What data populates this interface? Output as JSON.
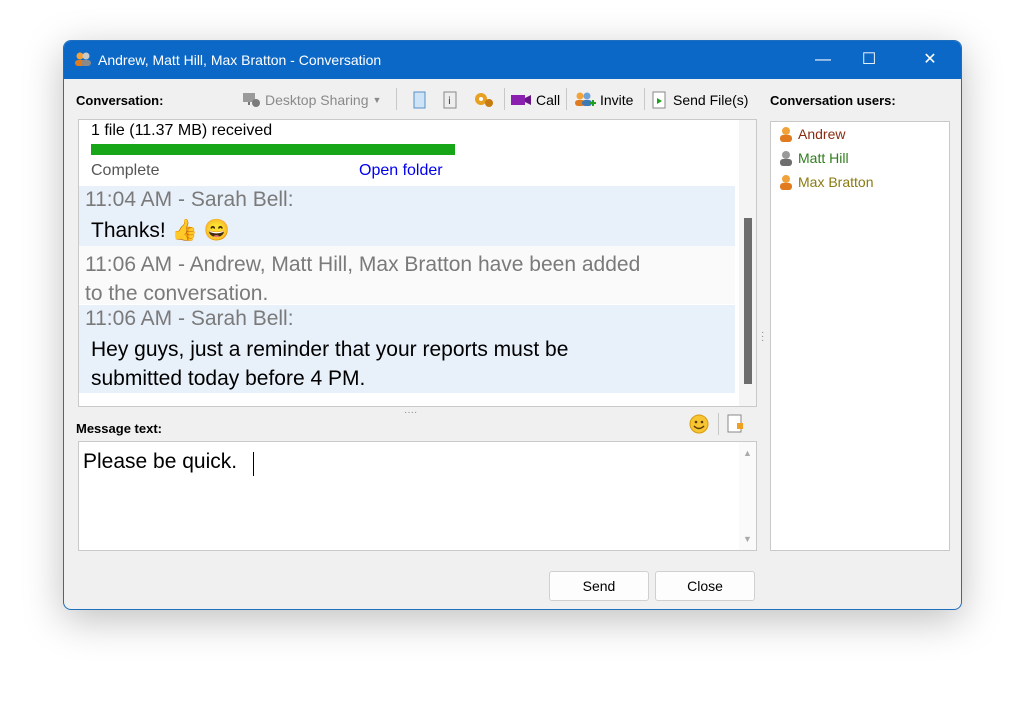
{
  "window": {
    "title": "Andrew, Matt Hill, Max Bratton - Conversation"
  },
  "titlebar_buttons": {
    "minimize": "—",
    "maximize": "☐",
    "close": "✕"
  },
  "conversation": {
    "label": "Conversation:",
    "toolbar": {
      "desktop_sharing": "Desktop Sharing",
      "call": "Call",
      "invite": "Invite",
      "send_files": "Send File(s)"
    }
  },
  "file_transfer": {
    "status_text": "1 file (11.37 MB) received",
    "progress": 1.0,
    "state": "Complete",
    "open_folder": "Open folder"
  },
  "messages": [
    {
      "header": "11:04 AM - Sarah Bell:",
      "body": "Thanks!",
      "emoji": "👍 😄"
    },
    {
      "header": "11:06 AM - Andrew, Matt Hill, Max Bratton have been added",
      "header2": "to the conversation."
    },
    {
      "header": "11:06 AM - Sarah Bell:",
      "body": "Hey guys, just a reminder that your reports must be",
      "body2": "submitted today before 4 PM."
    }
  ],
  "message_text": {
    "label": "Message text:",
    "value": "Please be quick."
  },
  "users_panel": {
    "label": "Conversation users:",
    "users": [
      {
        "name": "Andrew",
        "color": "#8b2c10"
      },
      {
        "name": "Matt Hill",
        "color": "#2f7d1e"
      },
      {
        "name": "Max Bratton",
        "color": "#8a7a10"
      }
    ]
  },
  "buttons": {
    "send": "Send",
    "close": "Close"
  },
  "colors": {
    "titlebar": "#0c68c6",
    "progress": "#17a617",
    "link": "#0000ee"
  }
}
